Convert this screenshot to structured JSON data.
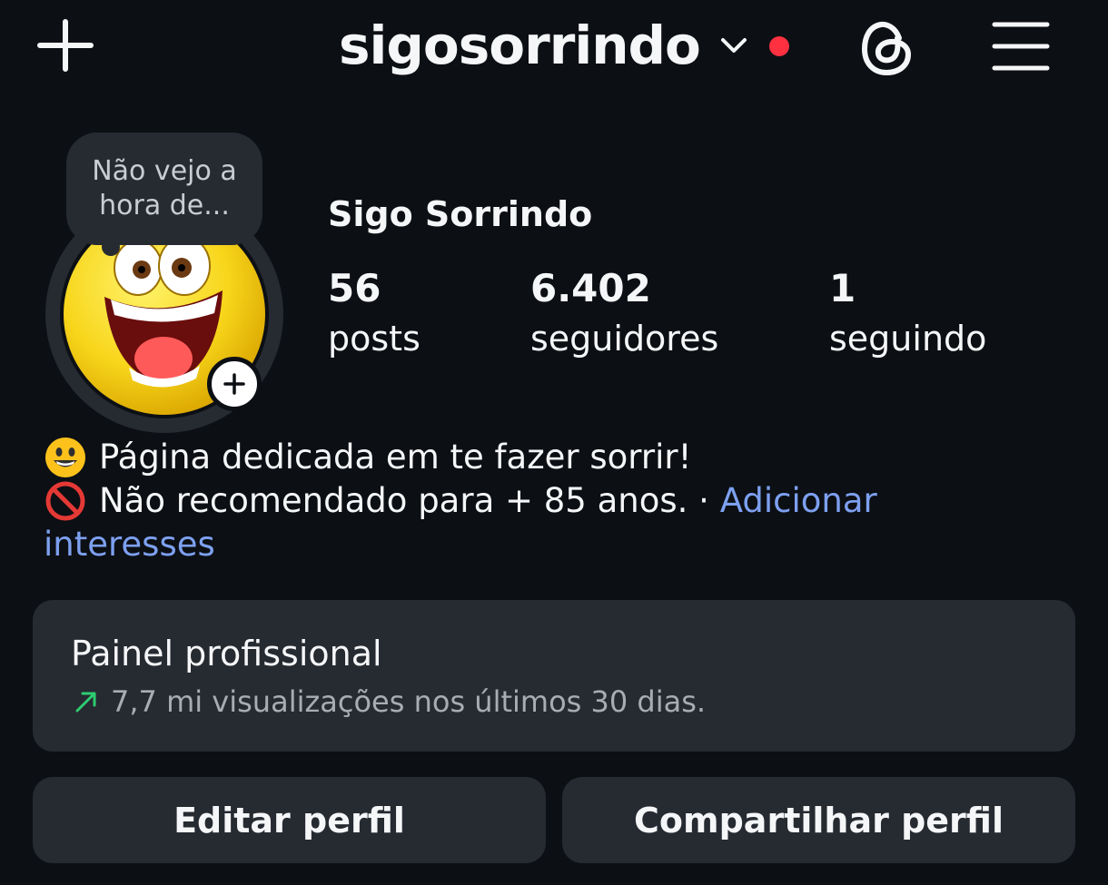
{
  "header": {
    "username": "sigosorrindo",
    "notification_dot_color": "#ff3040",
    "icons": [
      "plus-icon",
      "chevron-down-icon",
      "threads-icon",
      "menu-icon"
    ]
  },
  "note": {
    "text": "Não vejo a hora de..."
  },
  "profile": {
    "display_name": "Sigo Sorrindo",
    "stats": [
      {
        "value": "56",
        "label": "posts"
      },
      {
        "value": "6.402",
        "label": "seguidores"
      },
      {
        "value": "1",
        "label": "seguindo"
      }
    ]
  },
  "bio": {
    "line1": "Página dedicada em te fazer sorrir!",
    "line2": "Não recomendado para + 85 anos.",
    "separator": "·",
    "link_part1": "Adicionar",
    "link_part2": "interesses",
    "emojis": [
      "smiley-emoji",
      "prohibited-emoji"
    ]
  },
  "professional_panel": {
    "title": "Painel profissional",
    "subtitle": "7,7 mi visualizações nos últimos 30 dias.",
    "trend_color": "#2ecc71"
  },
  "buttons": {
    "edit": "Editar perfil",
    "share": "Compartilhar perfil"
  },
  "colors": {
    "background": "#0c0f14",
    "surface": "#262a31",
    "link": "#7da0f0"
  }
}
